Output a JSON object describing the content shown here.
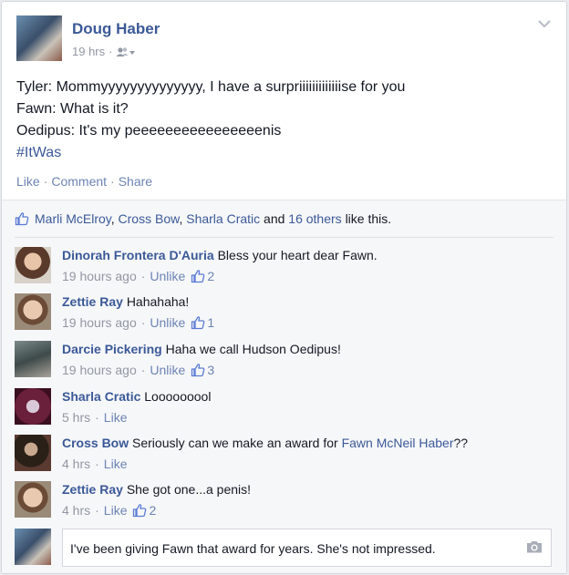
{
  "post": {
    "author": "Doug Haber",
    "time": "19 hrs",
    "lines": [
      "Tyler: Mommyyyyyyyyyyyyyy, I have a surpriiiiiiiiiiiiise for you",
      "Fawn: What is it?",
      "Oedipus: It's my peeeeeeeeeeeeeeeenis"
    ],
    "hashtag": "#ItWas"
  },
  "actions": {
    "like": "Like",
    "comment": "Comment",
    "share": "Share"
  },
  "likes": {
    "names": [
      "Marli McElroy",
      "Cross Bow",
      "Sharla Cratic"
    ],
    "and": "and",
    "others": "16 others",
    "suffix": "like this."
  },
  "comments": [
    {
      "name": "Dinorah Frontera D'Auria",
      "text": "Bless your heart dear Fawn.",
      "time": "19 hours ago",
      "action": "Unlike",
      "likes": "2"
    },
    {
      "name": "Zettie Ray",
      "text": "Hahahaha!",
      "time": "19 hours ago",
      "action": "Unlike",
      "likes": "1"
    },
    {
      "name": "Darcie Pickering",
      "text": "Haha we call Hudson Oedipus!",
      "time": "19 hours ago",
      "action": "Unlike",
      "likes": "3"
    },
    {
      "name": "Sharla Cratic",
      "text": "Looooooool",
      "time": "5 hrs",
      "action": "Like"
    },
    {
      "name": "Cross Bow",
      "text": "Seriously can we make an award for",
      "link": "Fawn McNeil Haber",
      "text_after": "??",
      "time": "4 hrs",
      "action": "Like"
    },
    {
      "name": "Zettie Ray",
      "text": "She got one...a penis!",
      "time": "4 hrs",
      "action": "Like",
      "likes": "2"
    }
  ],
  "reply": {
    "value": "I've been giving Fawn that award for years.  She's not impressed."
  },
  "colors": {
    "link": "#3b5998",
    "meta": "#9197a3",
    "ufi_bg": "#f6f7f9"
  }
}
